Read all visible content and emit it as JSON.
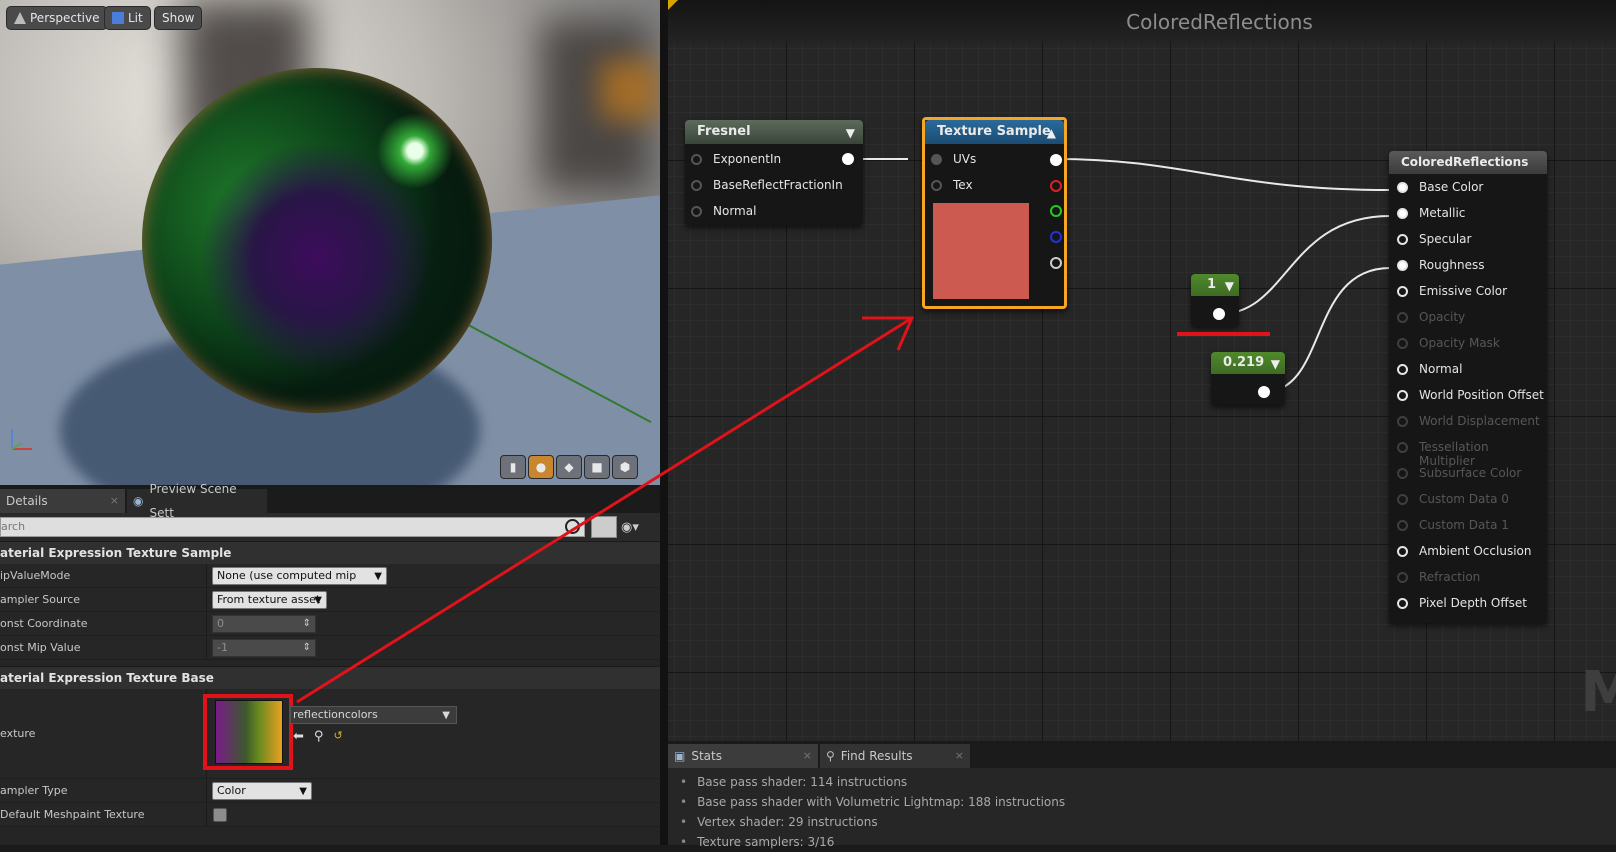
{
  "viewport": {
    "buttons": {
      "perspective": "Perspective",
      "lit": "Lit",
      "show": "Show"
    }
  },
  "details": {
    "tabs": [
      {
        "label": "Details"
      },
      {
        "label": "Preview Scene Sett"
      }
    ],
    "search_placeholder": "arch",
    "sections": [
      {
        "title": "aterial Expression Texture Sample",
        "rows": [
          {
            "label": "ipValueMode",
            "value": "None (use computed mip level)"
          },
          {
            "label": "ampler Source",
            "value": "From texture asset"
          },
          {
            "label": "onst Coordinate",
            "value": "0"
          },
          {
            "label": "onst Mip Value",
            "value": "-1"
          }
        ]
      },
      {
        "title": "aterial Expression Texture Base",
        "rows": [
          {
            "label": "exture",
            "value": "reflectioncolors"
          },
          {
            "label": "ampler Type",
            "value": "Color"
          },
          {
            "label": "Default Meshpaint Texture",
            "value": ""
          }
        ]
      }
    ]
  },
  "graph": {
    "title": "ColoredReflections",
    "watermark": "M",
    "nodes": {
      "fresnel": {
        "title": "Fresnel",
        "inputs": [
          "ExponentIn",
          "BaseReflectFractionIn",
          "Normal"
        ]
      },
      "texture_sample": {
        "title": "Texture Sample",
        "inputs": [
          "UVs",
          "Tex"
        ],
        "preview_color": "#cd5a50"
      },
      "const1": {
        "title": "1"
      },
      "const2": {
        "title": "0.219"
      },
      "material": {
        "title": "ColoredReflections",
        "inputs": [
          {
            "label": "Base Color",
            "enabled": true,
            "connected": true
          },
          {
            "label": "Metallic",
            "enabled": true,
            "connected": true
          },
          {
            "label": "Specular",
            "enabled": true,
            "connected": false
          },
          {
            "label": "Roughness",
            "enabled": true,
            "connected": true
          },
          {
            "label": "Emissive Color",
            "enabled": true,
            "connected": false
          },
          {
            "label": "Opacity",
            "enabled": false,
            "connected": false
          },
          {
            "label": "Opacity Mask",
            "enabled": false,
            "connected": false
          },
          {
            "label": "Normal",
            "enabled": true,
            "connected": false
          },
          {
            "label": "World Position Offset",
            "enabled": true,
            "connected": false
          },
          {
            "label": "World Displacement",
            "enabled": false,
            "connected": false
          },
          {
            "label": "Tessellation Multiplier",
            "enabled": false,
            "connected": false
          },
          {
            "label": "Subsurface Color",
            "enabled": false,
            "connected": false
          },
          {
            "label": "Custom Data 0",
            "enabled": false,
            "connected": false
          },
          {
            "label": "Custom Data 1",
            "enabled": false,
            "connected": false
          },
          {
            "label": "Ambient Occlusion",
            "enabled": true,
            "connected": false
          },
          {
            "label": "Refraction",
            "enabled": false,
            "connected": false
          },
          {
            "label": "Pixel Depth Offset",
            "enabled": true,
            "connected": false
          }
        ]
      }
    }
  },
  "stats": {
    "tabs": [
      {
        "label": "Stats"
      },
      {
        "label": "Find Results"
      }
    ],
    "lines": [
      "Base pass shader: 114 instructions",
      "Base pass shader with Volumetric Lightmap: 188 instructions",
      "Vertex shader: 29 instructions",
      "Texture samplers: 3/16"
    ]
  },
  "colors": {
    "annotation_red": "#e0121a",
    "selection_orange": "#f5a623",
    "texture_header": "#1b4c74",
    "const_header": "#3e6b22"
  },
  "icons": [
    "viewport-mode-icon",
    "lit-cube-icon",
    "search-icon",
    "close-icon",
    "eye-icon",
    "browse-arrow-icon",
    "magnifier-icon",
    "reset-icon",
    "collapse-triangle-icon"
  ]
}
